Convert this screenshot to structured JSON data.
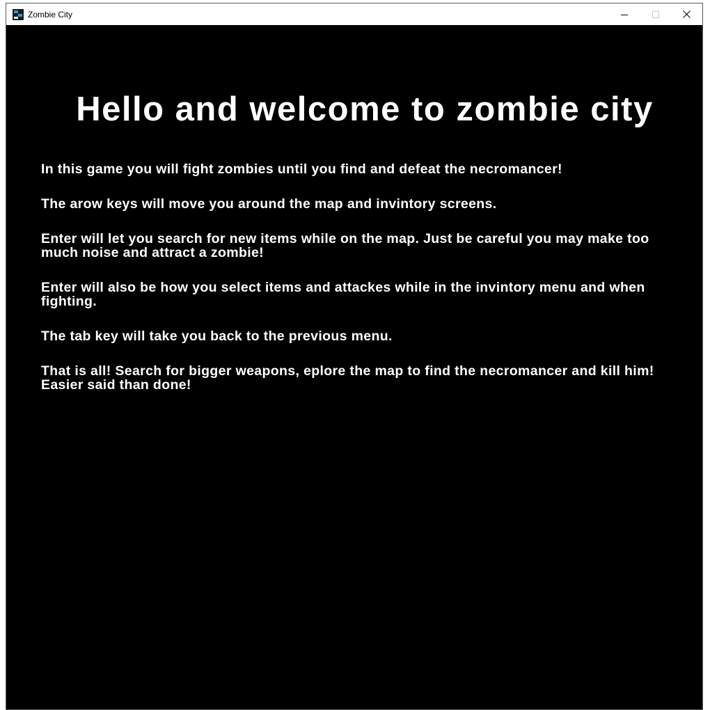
{
  "window": {
    "title": "Zombie City",
    "icon": "zombie-city-app-icon",
    "controls": {
      "minimize_icon": "minimize-icon",
      "maximize_icon": "maximize-icon",
      "close_icon": "close-icon"
    }
  },
  "screen": {
    "heading": "Hello and welcome to zombie city",
    "paragraphs": [
      "In this game you will fight zombies until you find and defeat the necromancer!",
      "The arow keys will move you around the map and invintory screens.",
      "Enter will let you search for new items while on the map. Just be careful you may make too much noise and attract a zombie!",
      "Enter will also be how you select items and attackes while in the invintory menu and when fighting.",
      "The tab key will take you back to the previous menu.",
      "That is all! Search for bigger weapons, eplore the map to find the necromancer and kill him! Easier said than done!"
    ]
  },
  "colors": {
    "background": "#000000",
    "text": "#ffffff",
    "titlebar": "#ffffff",
    "icon_accent": "#16a3e6"
  }
}
